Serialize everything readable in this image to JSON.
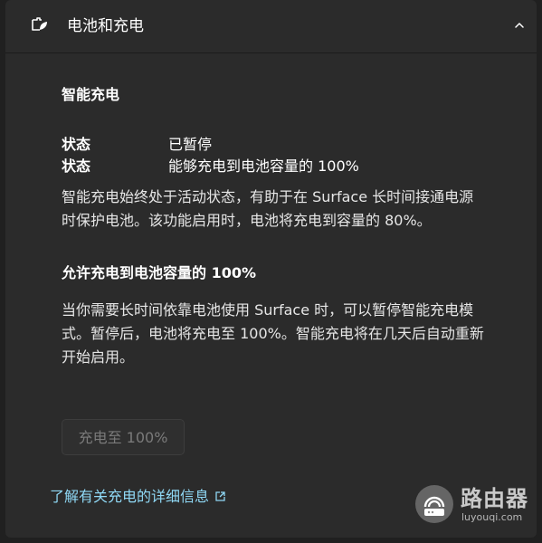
{
  "header": {
    "title": "电池和充电",
    "icon": "battery-leaf-icon",
    "chevron": "chevron-up-icon"
  },
  "smart_charging": {
    "title": "智能充电",
    "status_rows": [
      {
        "label": "状态",
        "value": "已暂停"
      },
      {
        "label": "状态",
        "value": "能够充电到电池容量的 100%"
      }
    ],
    "description": "智能充电始终处于活动状态，有助于在 Surface 长时间接通电源时保护电池。该功能启用时，电池将充电到容量的 80%。"
  },
  "allow_full": {
    "title": "允许充电到电池容量的 100%",
    "description": "当你需要长时间依靠电池使用 Surface 时，可以暂停智能充电模式。暂停后，电池将充电至 100%。智能充电将在几天后自动重新开始启用。",
    "button_label": "充电至 100%",
    "button_enabled": false
  },
  "learn_more": {
    "label": "了解有关充电的详细信息",
    "icon": "external-link-icon",
    "color": "#8fd8f5"
  },
  "watermark": {
    "title": "路由器",
    "subtitle": "luyouqi.com"
  }
}
